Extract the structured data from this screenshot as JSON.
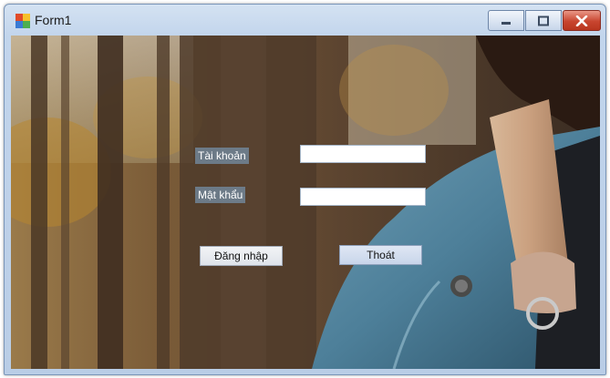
{
  "window": {
    "title": "Form1"
  },
  "caption_buttons": {
    "minimize_icon": "minimize-icon",
    "maximize_icon": "maximize-icon",
    "close_icon": "close-icon"
  },
  "form": {
    "username_label": "Tài khoản",
    "username_value": "",
    "password_label": "Mật khẩu",
    "password_value": "",
    "login_button": "Đăng nhập",
    "exit_button": "Thoát"
  },
  "colors": {
    "titlebar": "#c9daee",
    "close_button": "#c8452f",
    "label_bg": "#7691aa"
  }
}
